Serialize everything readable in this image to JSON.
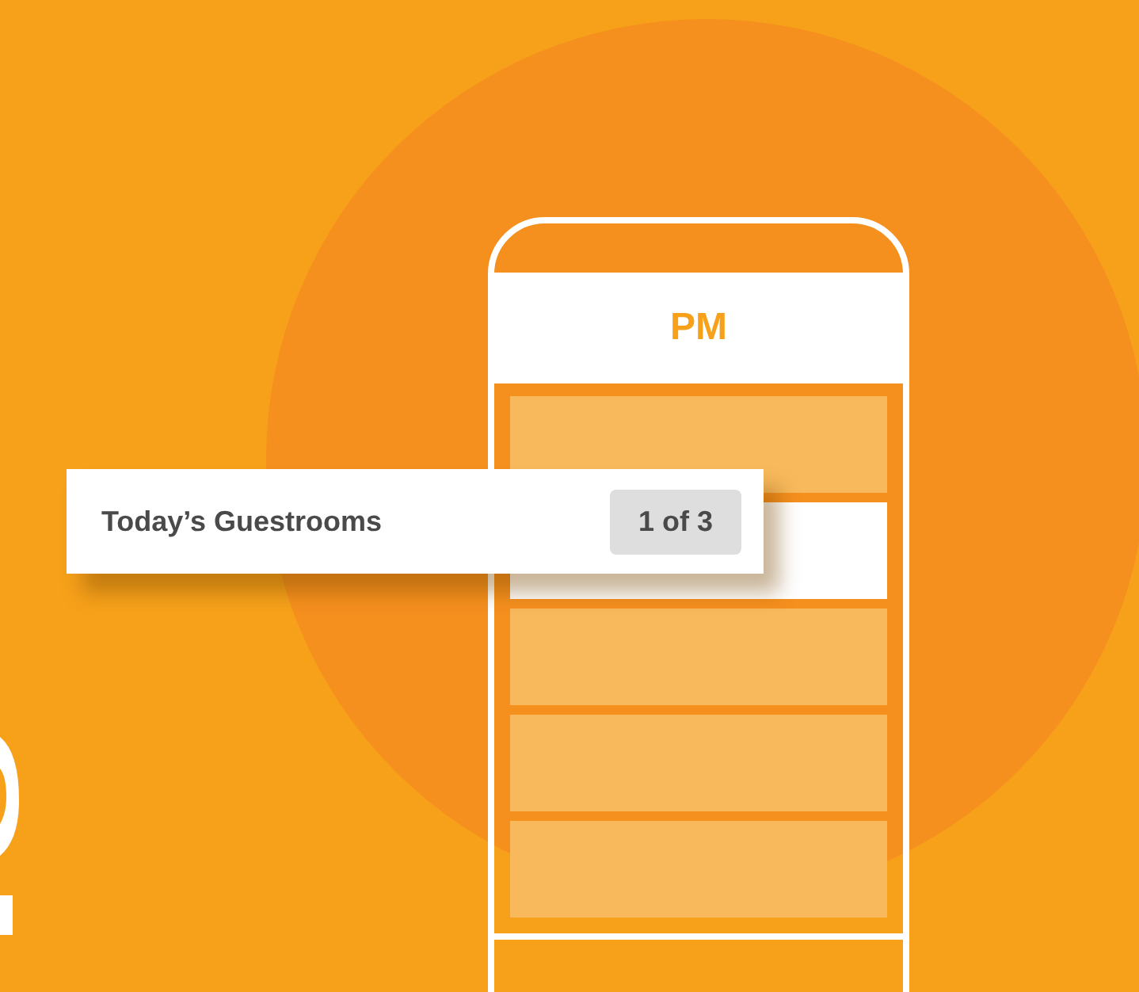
{
  "phone": {
    "header": "PM",
    "rows": [
      {
        "selected": false
      },
      {
        "selected": true
      },
      {
        "selected": false
      },
      {
        "selected": false
      },
      {
        "selected": false
      }
    ]
  },
  "card": {
    "title": "Today’s Guestrooms",
    "badge": "1 of 3"
  }
}
